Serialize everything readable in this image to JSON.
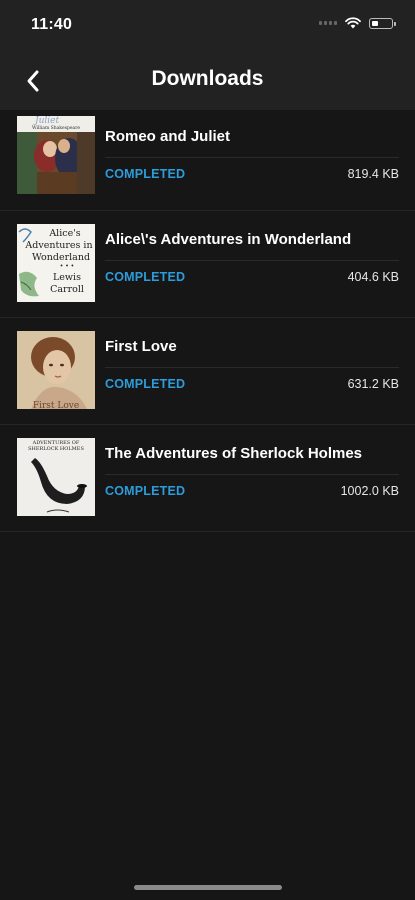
{
  "status_bar": {
    "time": "11:40"
  },
  "header": {
    "title": "Downloads"
  },
  "downloads": [
    {
      "title": "Romeo and Juliet",
      "status": "COMPLETED",
      "size": "819.4 KB",
      "cover_text": "William Shakespeare"
    },
    {
      "title": "Alice\\'s Adventures in Wonderland",
      "status": "COMPLETED",
      "size": "404.6 KB",
      "cover_text": "Alice's Adventures in Wonderland — Lewis Carroll"
    },
    {
      "title": "First Love",
      "status": "COMPLETED",
      "size": "631.2 KB",
      "cover_text": "First Love"
    },
    {
      "title": "The Adventures of Sherlock Holmes",
      "status": "COMPLETED",
      "size": "1002.0 KB",
      "cover_text": "ADVENTURES OF SHERLOCK HOLMES"
    }
  ],
  "colors": {
    "background": "#161616",
    "header": "#222222",
    "status_accent": "#2d9cdb"
  }
}
